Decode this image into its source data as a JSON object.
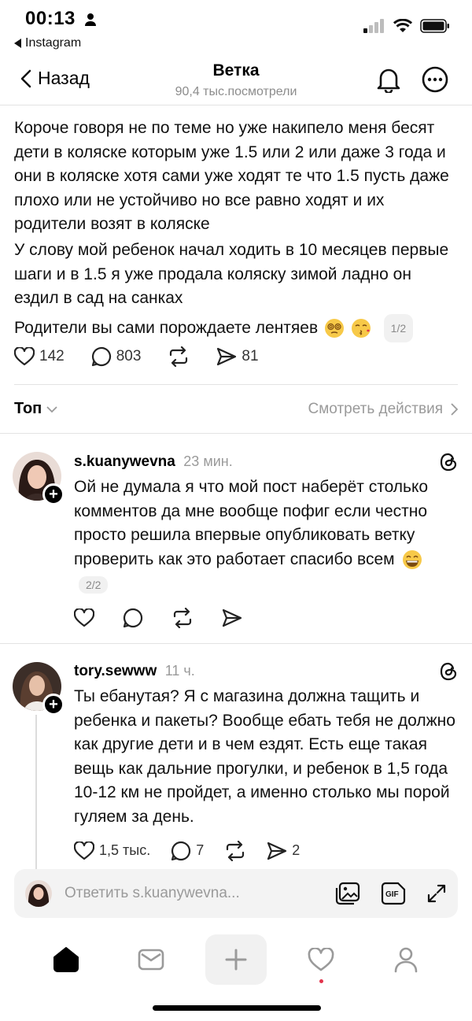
{
  "status_bar": {
    "time": "00:13",
    "back_app": "Instagram"
  },
  "nav": {
    "back_label": "Назад",
    "title": "Ветка",
    "subtitle": "90,4 тыс.посмотрели"
  },
  "post": {
    "paragraphs": [
      "Короче говоря не по теме но уже накипело меня бесят дети в коляске которым уже 1.5 или 2 или даже 3 года и они в коляске хотя сами уже ходят те что 1.5 пусть даже плохо или не устойчиво но все равно ходят и их родители возят в коляске",
      "У слову мой ребенок начал ходить в 10 месяцев первые шаги и в 1.5 я уже продала коляску зимой ладно он ездил в сад на санках"
    ],
    "last_line": "Родители вы сами порождаете лентяев",
    "pager": "1/2",
    "likes": "142",
    "comments": "803",
    "shares": "81"
  },
  "sort": {
    "label": "Топ",
    "view_activity": "Смотреть действия"
  },
  "comments": [
    {
      "username": "s.kuanywevna",
      "time": "23 мин.",
      "text": "Ой не думала я что мой пост наберёт столько комментов да мне вообще пофиг если честно просто решила впервые опубликовать ветку проверить как это работает спасибо всем",
      "pager": "2/2"
    },
    {
      "username": "tory.sewww",
      "time": "11 ч.",
      "text": "Ты ебанутая? Я с магазина должна тащить и ребенка и пакеты? Вообще ебать тебя не должно как другие дети и в чем ездят. Есть еще такая вещь как дальние прогулки, и ребенок в 1,5 года 10-12 км не пройдет, а именно столько мы порой гуляем за день.",
      "likes": "1,5 тыс.",
      "comments": "7",
      "shares": "2"
    }
  ],
  "reply": {
    "placeholder": "Ответить s.kuanywevna..."
  },
  "colors": {
    "notification_dot": "#e2334b",
    "muted_text": "#9a9a9a",
    "divider": "#e3e3e3"
  }
}
